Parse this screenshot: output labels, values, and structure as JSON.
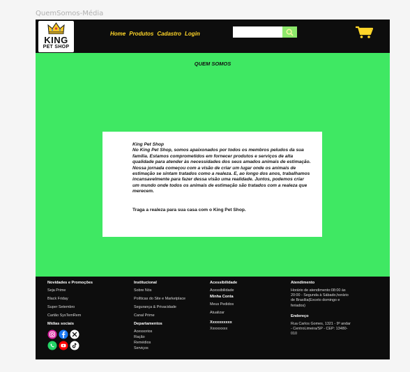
{
  "frame_label": "QuemSomos-Média",
  "brand": {
    "name": "KING",
    "sub": "PET SHOP"
  },
  "nav": [
    {
      "label": "Home"
    },
    {
      "label": "Produtos"
    },
    {
      "label": "Cadastro"
    },
    {
      "label": "Login"
    }
  ],
  "search": {
    "value": "",
    "placeholder": ""
  },
  "page_title": "QUEM SOMOS",
  "card": {
    "heading": "King Pet Shop",
    "p1": "No King Pet Shop, somos apaixonados por todos os membros peludos da sua família. Estamos comprometidos em fornecer produtos e serviços de alta qualidade para atender às necessidades dos seus amados animais de estimação.",
    "p2": "Nossa jornada começou com a visão de criar um lugar onde os animais de estimação se sintam tratados como a realeza. E, ao longo dos anos, trabalhamos incansavelmente para fazer dessa visão uma realidade. Juntos, podemos criar um mundo onde todos os animais de estimação são tratados com a realeza que merecem.",
    "cta": "Traga a realeza para sua casa com o King Pet Shop."
  },
  "footer": {
    "col1": {
      "heading": "Novidades e Promoções",
      "items": [
        "Seja Prime",
        "Black Friday",
        "Super Setembro",
        "Cartão SysTemRem"
      ],
      "social_heading": "Mídias sociais"
    },
    "col2": {
      "heading": "Institucional",
      "items": [
        "Sobre  Nós",
        "Políticas do Site e Marketplace",
        "Segurança & Privacidade",
        "Canal Prime"
      ],
      "heading2": "Departamentos",
      "items2": [
        "Acessorios",
        "Ração",
        "Remédios",
        "Serviços"
      ]
    },
    "col3": {
      "heading": "Acessibilidade",
      "item": "Acessibilidade",
      "heading2": "Minha Conta",
      "items2": [
        "Meus Pedidos",
        "Atualizar"
      ],
      "heading3": "Xxxxxxxxxx",
      "item3": "Xxxxxxxxx"
    },
    "col4": {
      "heading": "Atendimento",
      "hours": "Horário de atendimento:08:00 às 20:00 - Segunda à Sábado,horário de Brasília(Exceto domingo e feriados)",
      "heading2": "Endereço",
      "address": "Rua Carlos Gomes, 1321 - 9º andar - CentroLimeira/SP - CEP: 13480-010"
    }
  },
  "colors": {
    "page_bg": "#3fe863",
    "header_bg": "#0d0d0d",
    "nav_text": "#ffd629",
    "search_btn": "#8de86c",
    "card_bg": "#ffffff"
  },
  "icons": [
    "crown-icon",
    "search-icon",
    "cart-icon",
    "instagram-icon",
    "facebook-icon",
    "x-icon",
    "whatsapp-icon",
    "youtube-icon",
    "tiktok-icon"
  ]
}
